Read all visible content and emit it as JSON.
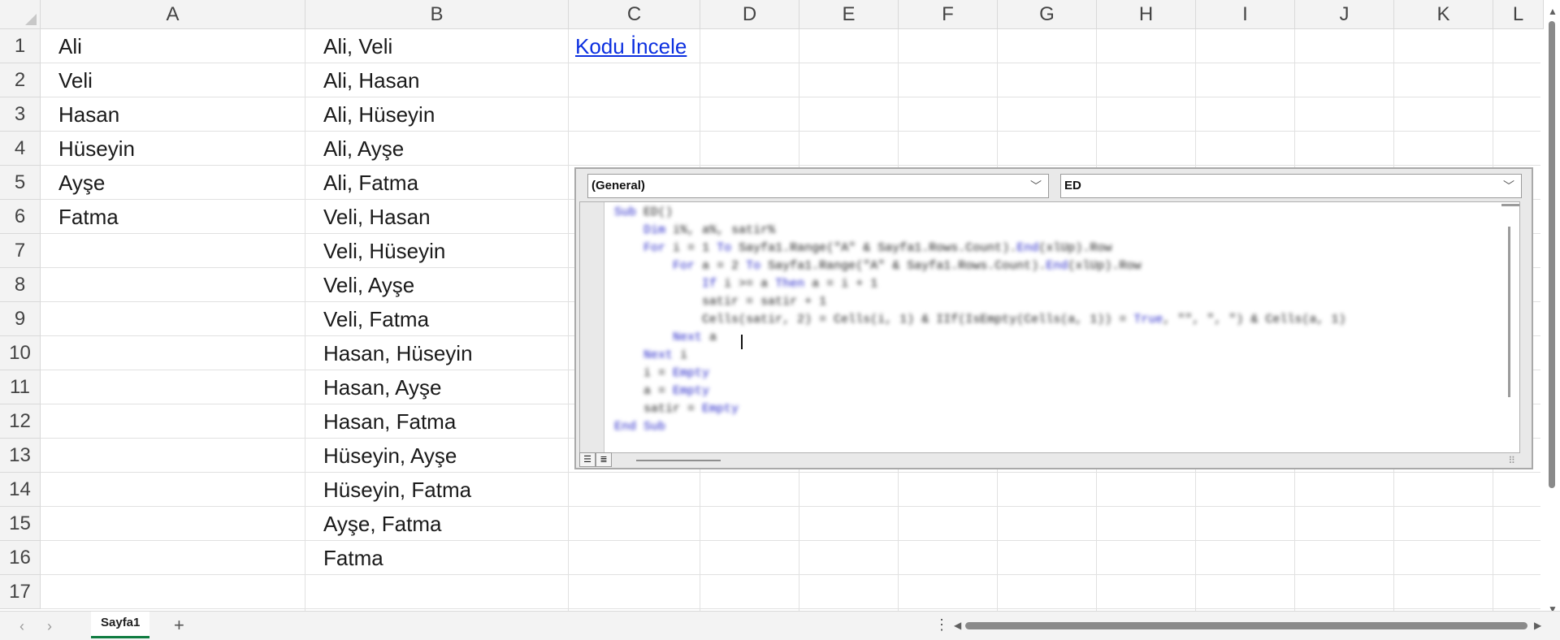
{
  "columns": [
    "A",
    "B",
    "C",
    "D",
    "E",
    "F",
    "G",
    "H",
    "I",
    "J",
    "K",
    "L"
  ],
  "rows": [
    "1",
    "2",
    "3",
    "4",
    "5",
    "6",
    "7",
    "8",
    "9",
    "10",
    "11",
    "12",
    "13",
    "14",
    "15",
    "16",
    "17"
  ],
  "colA": [
    "Ali",
    "Veli",
    "Hasan",
    "Hüseyin",
    "Ayşe",
    "Fatma"
  ],
  "colB": [
    "Ali, Veli",
    "Ali, Hasan",
    "Ali, Hüseyin",
    "Ali, Ayşe",
    "Ali, Fatma",
    "Veli, Hasan",
    "Veli, Hüseyin",
    "Veli, Ayşe",
    "Veli, Fatma",
    "Hasan, Hüseyin",
    "Hasan, Ayşe",
    "Hasan, Fatma",
    "Hüseyin, Ayşe",
    "Hüseyin, Fatma",
    "Ayşe, Fatma",
    "Fatma"
  ],
  "link": {
    "text": "Kodu İncele"
  },
  "vba": {
    "object_dropdown": "(General)",
    "procedure_dropdown": "ED",
    "code_lines": [
      "Sub ED()",
      "    Dim i%, a%, satir%",
      "    For i = 1 To Sayfa1.Range(\"A\" & Sayfa1.Rows.Count).End(xlUp).Row",
      "        For a = 2 To Sayfa1.Range(\"A\" & Sayfa1.Rows.Count).End(xlUp).Row",
      "            If i >= a Then a = i + 1",
      "            satir = satir + 1",
      "            Cells(satir, 2) = Cells(i, 1) & IIf(IsEmpty(Cells(a, 1)) = True, \"\", \", \") & Cells(a, 1)",
      "        Next a",
      "    Next i",
      "    i = Empty",
      "    a = Empty",
      "    satir = Empty",
      "End Sub"
    ]
  },
  "sheet_tabs": [
    "Sayfa1"
  ],
  "add_sheet_label": "+",
  "more_label": "⋮",
  "colors": {
    "accent": "#107c41",
    "link": "#0b2fe0",
    "keyword": "#2323c8"
  }
}
